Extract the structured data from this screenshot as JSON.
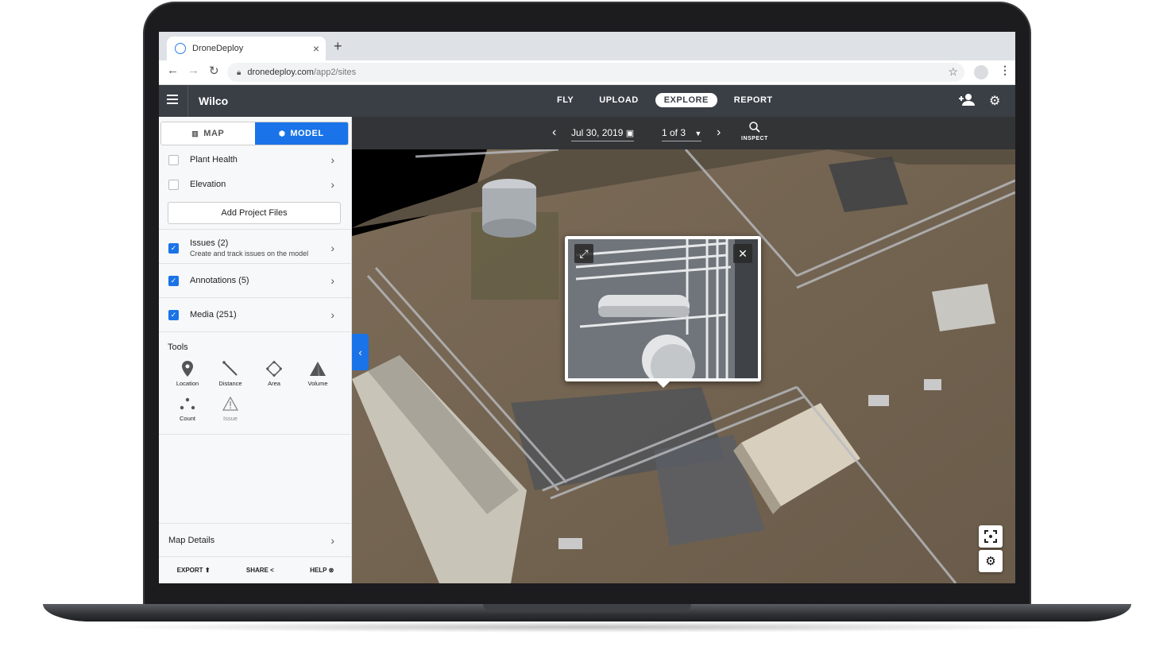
{
  "browser": {
    "tab_title": "DroneDeploy",
    "tab_close": "×",
    "new_tab": "+",
    "url_host": "dronedeploy.com",
    "url_path": "/app2/sites",
    "star": "☆",
    "menu": "⋮"
  },
  "header": {
    "project": "Wilco",
    "tabs": [
      "FLY",
      "UPLOAD",
      "EXPLORE",
      "REPORT"
    ],
    "active_tab": "EXPLORE"
  },
  "sidebar": {
    "toggle_map": "MAP",
    "toggle_model": "MODEL",
    "active_toggle": "MODEL",
    "layers": [
      {
        "label": "Plant Health",
        "checked": false
      },
      {
        "label": "Elevation",
        "checked": false
      }
    ],
    "add_files": "Add Project Files",
    "overlays": [
      {
        "label": "Issues (2)",
        "sub": "Create and track issues on the model",
        "checked": true
      },
      {
        "label": "Annotations (5)",
        "sub": "",
        "checked": true
      },
      {
        "label": "Media (251)",
        "sub": "",
        "checked": true
      }
    ],
    "tools_label": "Tools",
    "tools": [
      "Location",
      "Distance",
      "Area",
      "Volume",
      "Count",
      "Issue"
    ],
    "map_details": "Map Details",
    "footer": {
      "export": "EXPORT",
      "share": "SHARE",
      "help": "HELP"
    }
  },
  "map": {
    "date": "Jul 30, 2019",
    "pager": "1 of 3",
    "inspect": "INSPECT"
  },
  "colors": {
    "accent": "#1a73e8",
    "header": "#3a3f46",
    "terrain": "#6e5f4e"
  }
}
